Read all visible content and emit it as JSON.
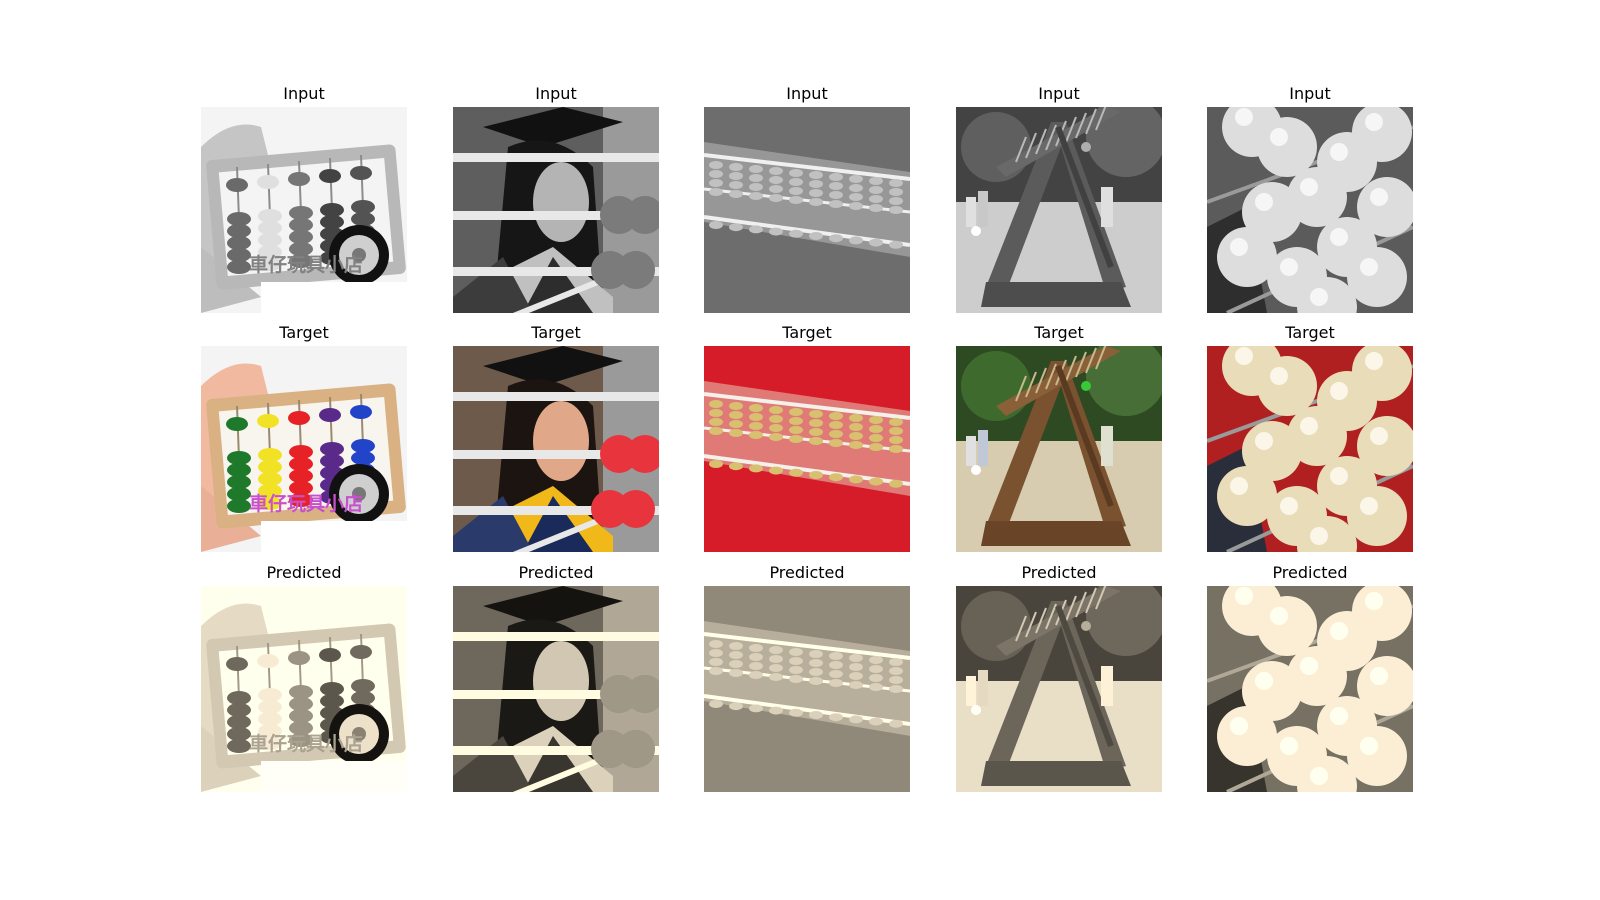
{
  "figure": {
    "rows": [
      {
        "title": "Input",
        "tone": "gray"
      },
      {
        "title": "Target",
        "tone": "color"
      },
      {
        "title": "Predicted",
        "tone": "sepia"
      }
    ],
    "watermark": "車仔玩具小店",
    "scenes": [
      {
        "id": "toy-abacus",
        "depicts": "hand holding a small toy abacus with a wheel sticker"
      },
      {
        "id": "graduate-abacus",
        "depicts": "graduate in a cap behind large abacus rods"
      },
      {
        "id": "glass-abacus",
        "depicts": "close-up of a clear abacus on red cloth"
      },
      {
        "id": "playground-abacus",
        "depicts": "giant wooden abacus frame in a park with children"
      },
      {
        "id": "beads-closeup",
        "depicts": "close-up of cream abacus beads on rods"
      }
    ]
  }
}
